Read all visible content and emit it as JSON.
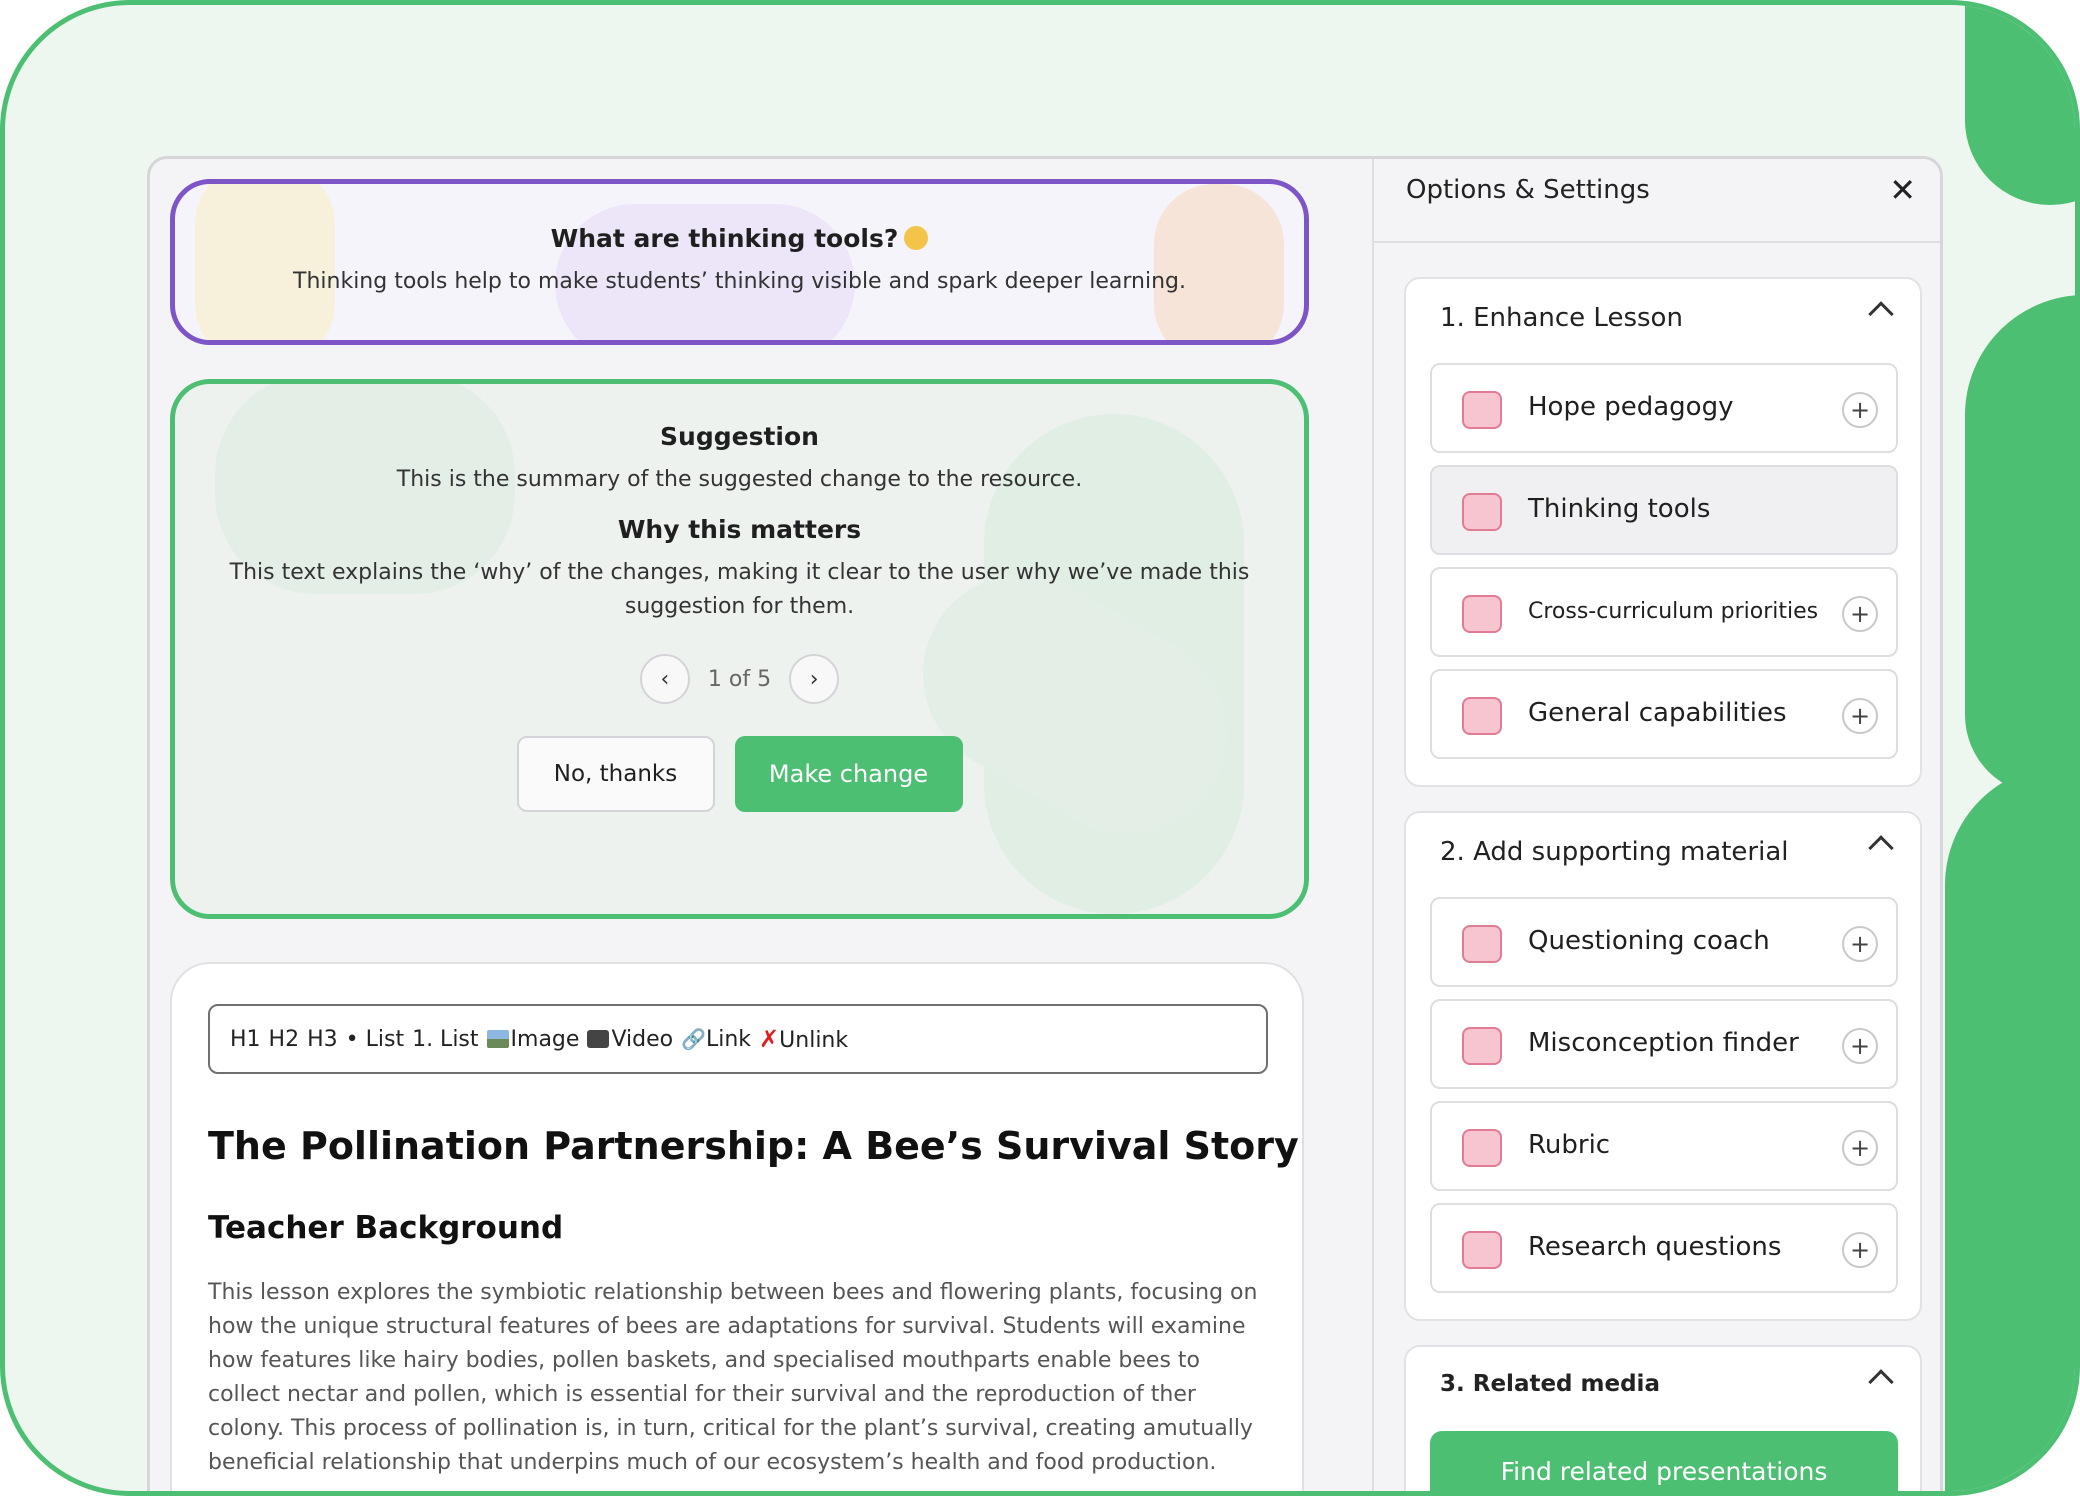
{
  "info_card": {
    "title": "What are thinking tools?",
    "text": "Thinking tools help to make students’ thinking visible and spark deeper learning."
  },
  "suggestion": {
    "heading": "Suggestion",
    "summary": "This is the summary of the suggested change to the resource.",
    "why_heading": "Why this matters",
    "why_text_line1": "This text explains the ‘why’ of the changes, making it clear to the user why we’ve made this",
    "why_text_line2": "suggestion for them.",
    "pager": "1 of 5",
    "decline_label": "No, thanks",
    "accept_label": "Make change"
  },
  "editor": {
    "toolbar": {
      "h1": "H1",
      "h2": "H2",
      "h3": "H3",
      "bullet_list": "• List",
      "numbered_list": "1. List",
      "image": "Image",
      "video": "Video",
      "link": "Link",
      "unlink": "Unlink"
    },
    "title": "The Pollination Partnership: A Bee’s Survival Story",
    "section_heading": "Teacher Background",
    "paragraph": "This lesson explores the symbiotic relationship between bees and flowering plants, focusing on how the unique structural features of bees are adaptations for survival. Students will examine how features like hairy bodies, pollen baskets, and specialised mouthparts enable bees to collect nectar and pollen, which is essential for their survival and the reproduction of ther colony. This process of pollination is, in turn, critical for the plant’s survival, creating amutually beneficial relationship that underpins much of our ecosystem’s health and food production."
  },
  "panel": {
    "title": "Options & Settings",
    "sections": [
      {
        "title": "1. Enhance Lesson",
        "items": [
          {
            "label": "Hope pedagogy",
            "icon": "hope-pedagogy-icon"
          },
          {
            "label": "Thinking tools",
            "icon": "brain-icon"
          },
          {
            "label": "Cross-curriculum priorities",
            "icon": "book-icon"
          },
          {
            "label": "General capabilities",
            "icon": "notebook-icon"
          }
        ]
      },
      {
        "title": "2. Add supporting material",
        "items": [
          {
            "label": "Questioning coach",
            "icon": "coach-icon"
          },
          {
            "label": "Misconception finder",
            "icon": "heart-hands-icon"
          },
          {
            "label": "Rubric",
            "icon": "rubric-icon"
          },
          {
            "label": "Research questions",
            "icon": "open-book-icon"
          }
        ]
      },
      {
        "title": "3. Related media",
        "button": "Find related presentations"
      }
    ]
  },
  "colors": {
    "accent_green": "#4cbf73",
    "accent_purple": "#7d55c7"
  }
}
